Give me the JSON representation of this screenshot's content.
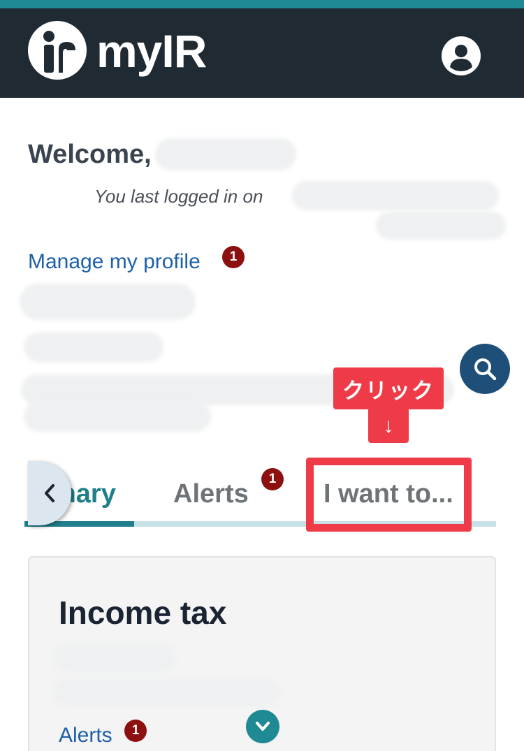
{
  "header": {
    "app_name": "myIR",
    "colors": {
      "top_strip": "#1f8a94",
      "bar": "#1f2a33"
    },
    "logo_icon": "ir-logo-icon",
    "account_icon": "account-circle-icon"
  },
  "welcome": {
    "greeting": "Welcome,",
    "last_login": "You last logged in on"
  },
  "profile": {
    "manage_link": "Manage my profile",
    "badge_count": "1"
  },
  "search": {
    "icon": "search-icon"
  },
  "annotation": {
    "label": "クリック",
    "arrow": "↓",
    "color": "#ef3b48"
  },
  "tabs": {
    "prev_icon": "chevron-left-icon",
    "items": [
      {
        "label": "mary",
        "active": true
      },
      {
        "label": "Alerts",
        "badge": "1"
      },
      {
        "label": "I want to..."
      }
    ],
    "accent": "#1f7f8c"
  },
  "income_card": {
    "title": "Income tax",
    "alerts_link": "Alerts",
    "alerts_badge": "1",
    "expand_icon": "chevron-down-icon"
  }
}
